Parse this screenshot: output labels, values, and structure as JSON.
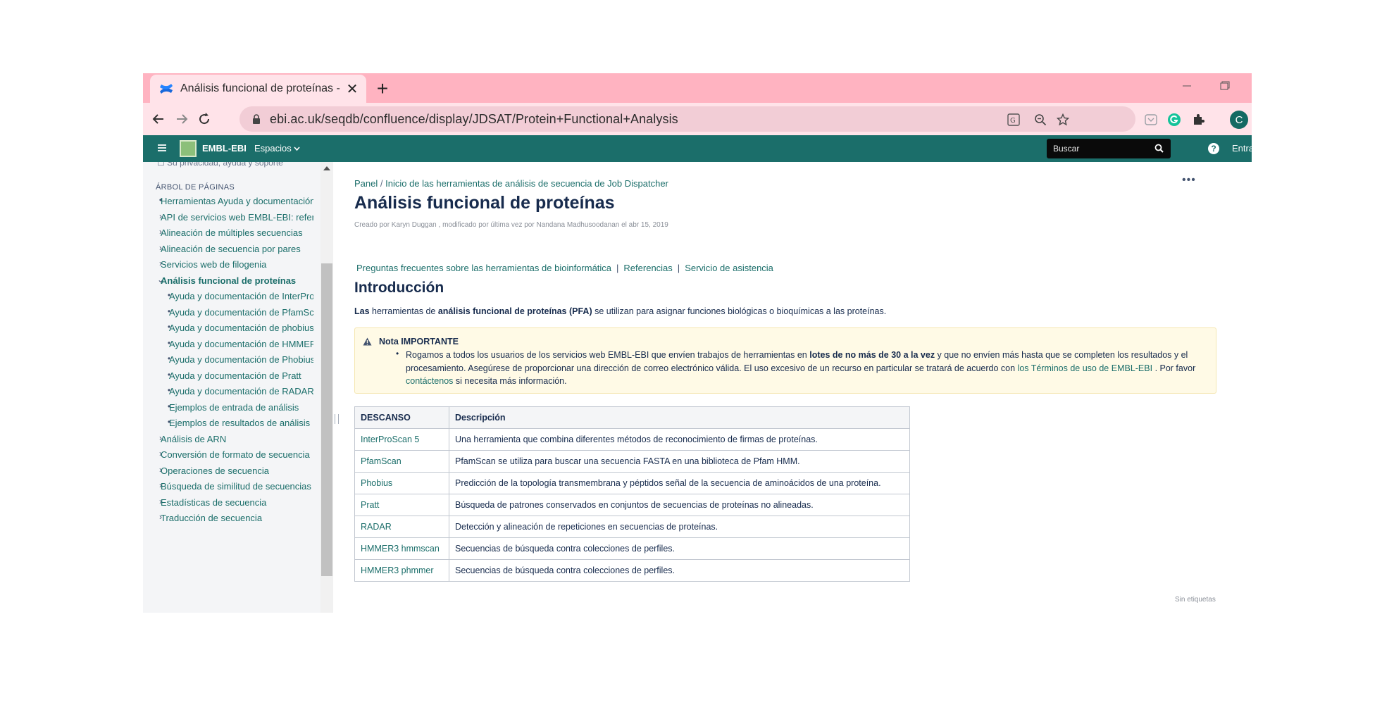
{
  "browser": {
    "tab_title": "Análisis funcional de proteínas -",
    "url": "ebi.ac.uk/seqdb/confluence/display/JDSAT/Protein+Functional+Analysis",
    "profile_initial": "C"
  },
  "header": {
    "brand": "EMBL-EBI",
    "spaces": "Espacios",
    "search_placeholder": "Buscar",
    "login": "Entrar"
  },
  "sidebar": {
    "cut_item": "Su privacidad, ayuda y soporte",
    "tree_heading": "ÁRBOL DE PÁGINAS",
    "items": [
      {
        "marker": "•",
        "label": "Herramientas Ayuda y documentación",
        "level": 0
      },
      {
        "marker": "›",
        "label": "API de servicios web EMBL-EBI: referencia",
        "level": 0
      },
      {
        "marker": "›",
        "label": "Alineación de múltiples secuencias",
        "level": 0
      },
      {
        "marker": "›",
        "label": "Alineación de secuencia por pares",
        "level": 0
      },
      {
        "marker": "›",
        "label": "Servicios web de filogenia",
        "level": 0
      },
      {
        "marker": "⌄",
        "label": "Análisis funcional de proteínas",
        "level": 0,
        "active": true
      },
      {
        "marker": "•",
        "label": "Ayuda y documentación de InterProScan",
        "level": 1
      },
      {
        "marker": "•",
        "label": "Ayuda y documentación de PfamScan",
        "level": 1
      },
      {
        "marker": "•",
        "label": "Ayuda y documentación de phobius",
        "level": 1
      },
      {
        "marker": "•",
        "label": "Ayuda y documentación de HMMER",
        "level": 1
      },
      {
        "marker": "•",
        "label": "Ayuda y documentación de Phobius",
        "level": 1
      },
      {
        "marker": "•",
        "label": "Ayuda y documentación de Pratt",
        "level": 1
      },
      {
        "marker": "•",
        "label": "Ayuda y documentación de RADAR",
        "level": 1
      },
      {
        "marker": "•",
        "label": "Ejemplos de entrada de análisis",
        "level": 1
      },
      {
        "marker": "•",
        "label": "Ejemplos de resultados de análisis",
        "level": 1
      },
      {
        "marker": "›",
        "label": "Análisis de ARN",
        "level": 0
      },
      {
        "marker": "›",
        "label": "Conversión de formato de secuencia",
        "level": 0
      },
      {
        "marker": "›",
        "label": "Operaciones de secuencia",
        "level": 0
      },
      {
        "marker": "›",
        "label": "Búsqueda de similitud de secuencias",
        "level": 0
      },
      {
        "marker": "›",
        "label": "Estadísticas de secuencia",
        "level": 0
      },
      {
        "marker": "›",
        "label": "Traducción de secuencia",
        "level": 0
      }
    ]
  },
  "main": {
    "breadcrumb": [
      "Panel",
      "Inicio de las herramientas de análisis de secuencia de Job Dispatcher"
    ],
    "title": "Análisis funcional de proteínas",
    "meta": "Creado por Karyn Duggan , modificado por última vez por Nandana Madhusoodanan el abr 15, 2019",
    "links": [
      "Preguntas frecuentes sobre las herramientas de bioinformática",
      "Referencias",
      "Servicio de asistencia"
    ],
    "intro_heading": "Introducción",
    "intro": {
      "a": "Las",
      "b": " herramientas de ",
      "c": "análisis funcional de proteínas (PFA)",
      "d": "  se utilizan para asignar funciones biológicas o bioquímicas a las proteínas."
    },
    "note": {
      "title": "Nota IMPORTANTE",
      "t1": "Rogamos a todos los usuarios de los servicios web EMBL-EBI que envíen trabajos de herramientas en ",
      "t2": "lotes de no más de 30 a la vez",
      "t3": " y que no envíen más hasta que se completen los resultados y el procesamiento. Asegúrese de proporcionar una dirección de correo electrónico válida. El uso excesivo de un recurso en particular se tratará de acuerdo con  ",
      "link1": "los Términos de uso de EMBL-EBI",
      "t4": " . Por favor  ",
      "link2": "contáctenos",
      "t5": "  si necesita más información."
    },
    "table": {
      "headers": [
        "DESCANSO",
        "Descripción"
      ],
      "rows": [
        [
          "InterProScan 5",
          "Una herramienta que combina diferentes métodos de reconocimiento de firmas de proteínas."
        ],
        [
          "PfamScan",
          "PfamScan se utiliza para buscar una secuencia FASTA en una biblioteca de Pfam HMM."
        ],
        [
          "Phobius",
          "Predicción de la topología transmembrana y péptidos señal de la secuencia de aminoácidos de una proteína."
        ],
        [
          "Pratt",
          "Búsqueda de patrones conservados en conjuntos de secuencias de proteínas no alineadas."
        ],
        [
          "RADAR",
          "Detección y alineación de repeticiones en secuencias de proteínas."
        ],
        [
          "HMMER3 hmmscan",
          "Secuencias de búsqueda contra colecciones de perfiles."
        ],
        [
          "HMMER3 phmmer",
          "Secuencias de búsqueda contra colecciones de perfiles."
        ]
      ]
    },
    "labels_footer": "Sin etiquetas"
  }
}
